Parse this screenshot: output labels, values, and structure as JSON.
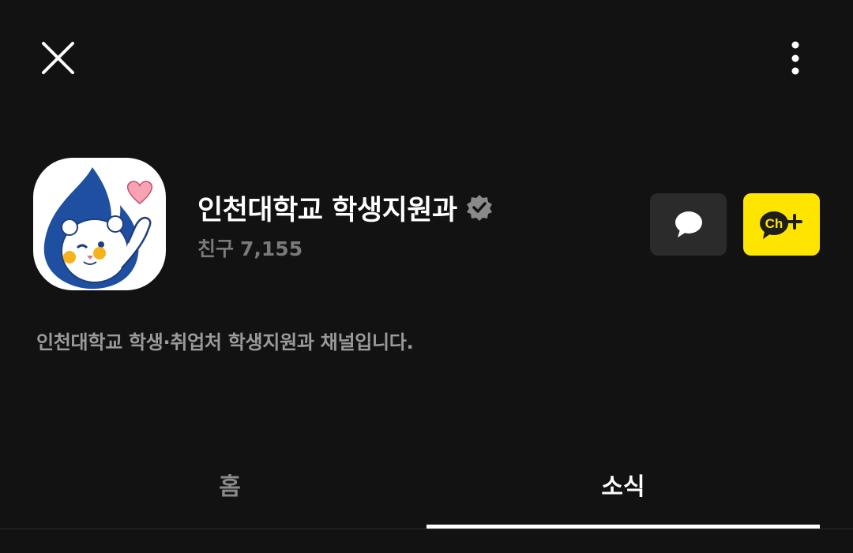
{
  "header": {
    "close_icon": "close-icon",
    "more_icon": "more-vertical-icon"
  },
  "profile": {
    "channel_name": "인천대학교 학생지원과",
    "verified_icon": "verified-badge-icon",
    "friends_label": "친구",
    "friends_count": "7,155",
    "description": "인천대학교 학생·취업처 학생지원과 채널입니다."
  },
  "actions": {
    "chat_icon": "chat-bubble-icon",
    "add_channel_icon": "channel-add-icon",
    "add_channel_text": "Ch",
    "add_color": "#fee500"
  },
  "tabs": [
    {
      "label": "홈",
      "active": false
    },
    {
      "label": "소식",
      "active": true
    }
  ]
}
